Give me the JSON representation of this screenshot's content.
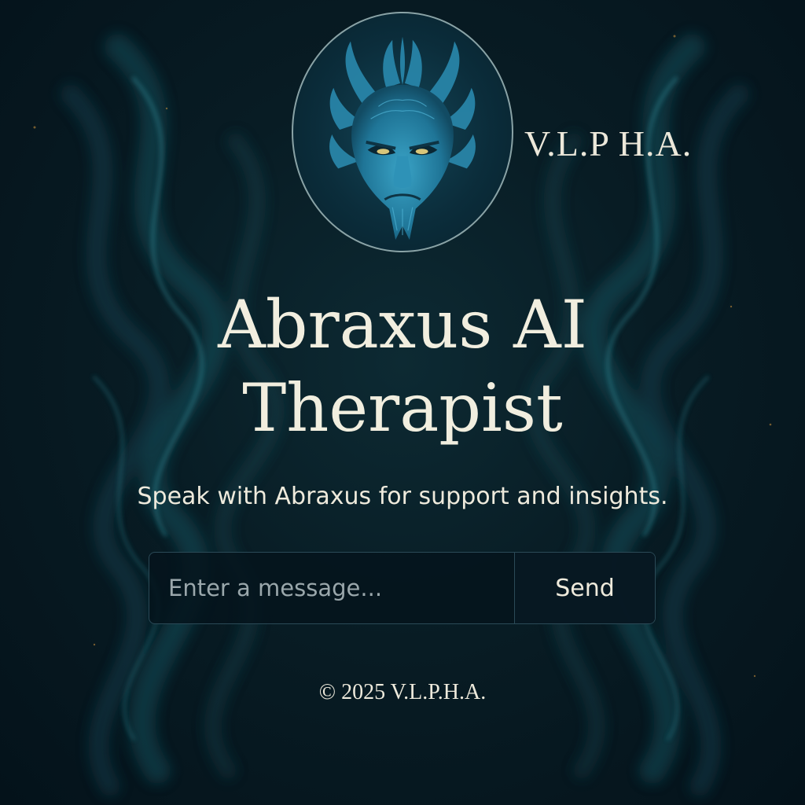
{
  "header": {
    "logo_icon": "demon-mask-icon",
    "brand": "V.L.P H.A."
  },
  "hero": {
    "title_line1": "Abraxus AI",
    "title_line2": "Therapist",
    "subtitle": "Speak with Abraxus for support and insights."
  },
  "composer": {
    "placeholder": "Enter a message...",
    "value": "",
    "send_label": "Send"
  },
  "footer": {
    "copyright": "© 2025 V.L.P.H.A."
  },
  "colors": {
    "background": "#081c24",
    "accent": "#2f8fb3",
    "text": "#f1eedf"
  }
}
